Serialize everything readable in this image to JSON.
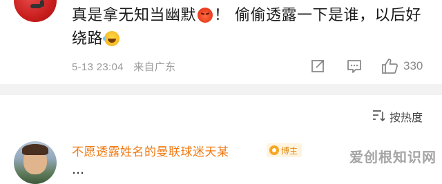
{
  "comment1": {
    "text_part1": "真是拿无知当幽默",
    "emoji1": "angry-emoji",
    "text_part2": "！ 偷偷透露一下是谁，以后好绕路",
    "emoji2": "laugh-tears-emoji",
    "date": "5-13 23:04",
    "location": "来自广东",
    "like_count": "330"
  },
  "sort": {
    "label": "按热度"
  },
  "comment2": {
    "username": "不愿透露姓名的曼联球迷天某",
    "badge_label": "博主",
    "partial_text": "…"
  },
  "watermark": "爱创根知识网",
  "colors": {
    "username": "#f07a14",
    "meta": "#9a9a9a",
    "divider": "#f2f2f2",
    "badge_bg": "#fff4e0"
  }
}
